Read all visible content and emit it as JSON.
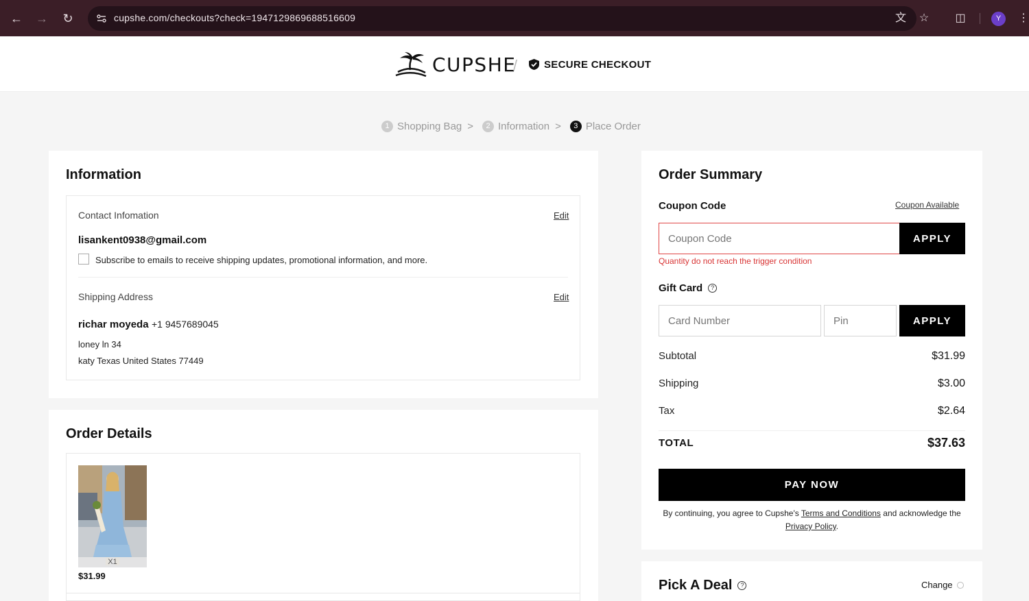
{
  "browser": {
    "url": "cupshe.com/checkouts?check=1947129869688516609",
    "avatar_letter": "Y"
  },
  "header": {
    "brand": "CUPSHE",
    "secure_label": "SECURE CHECKOUT"
  },
  "steps": [
    {
      "num": "1",
      "label": "Shopping Bag",
      "sep": ">"
    },
    {
      "num": "2",
      "label": "Information",
      "sep": ">"
    },
    {
      "num": "3",
      "label": "Place Order"
    }
  ],
  "information": {
    "title": "Information",
    "contact_label": "Contact Infomation",
    "edit_label": "Edit",
    "email": "lisankent0938@gmail.com",
    "subscribe_text": "Subscribe to emails to receive shipping updates, promotional information, and more.",
    "shipping_label": "Shipping Address",
    "name": "richar moyeda",
    "phone": "+1 9457689045",
    "address_line1": "loney ln 34",
    "address_line2": "katy Texas United States 77449"
  },
  "order_details": {
    "title": "Order Details",
    "quantity": "X1",
    "price": "$31.99"
  },
  "summary": {
    "title": "Order Summary",
    "coupon_label": "Coupon Code",
    "coupon_available": "Coupon Available",
    "coupon_placeholder": "Coupon Code",
    "apply_label": "APPLY",
    "coupon_error": "Quantity do not reach the trigger condition",
    "gift_card_label": "Gift Card",
    "card_number_placeholder": "Card Number",
    "pin_placeholder": "Pin",
    "rows": [
      {
        "label": "Subtotal",
        "value": "$31.99"
      },
      {
        "label": "Shipping",
        "value": "$3.00"
      },
      {
        "label": "Tax",
        "value": "$2.64"
      }
    ],
    "total_label": "TOTAL",
    "total_value": "$37.63",
    "pay_label": "PAY NOW",
    "legal_prefix": "By continuing, you agree to Cupshe's",
    "terms_link": "Terms and Conditions",
    "legal_mid": "and acknowledge the",
    "privacy_link": "Privacy Policy",
    "legal_suffix": "."
  },
  "deal": {
    "title": "Pick A Deal",
    "change_label": "Change"
  }
}
